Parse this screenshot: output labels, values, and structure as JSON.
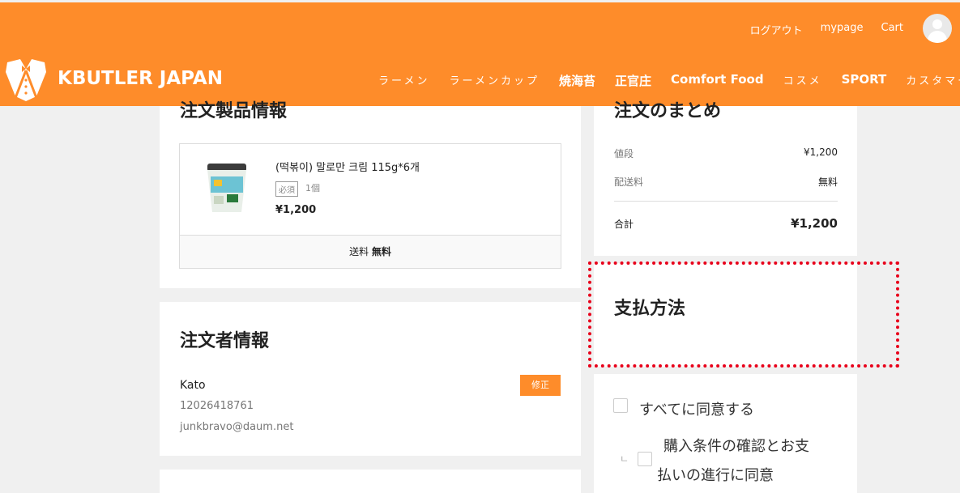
{
  "header": {
    "top_links": [
      "ログアウト",
      "mypage",
      "Cart"
    ],
    "logo_text": "KBUTLER JAPAN",
    "nav": [
      "ラーメン",
      "ラーメンカップ",
      "焼海苔",
      "正官庄",
      "Comfort Food",
      "コスメ",
      "SPORT",
      "カスタマーサ"
    ],
    "accent_color": "#fe8c2a"
  },
  "products": {
    "title": "注文製品情報",
    "item": {
      "name": "(떡볶이) 말로만 크림 115g*6개",
      "badge": "必須",
      "qty": "1個",
      "price": "¥1,200"
    },
    "shipping_label": "送料",
    "shipping_value": "無料"
  },
  "orderer": {
    "title": "注文者情報",
    "name": "Kato",
    "phone": "12026418761",
    "email": "junkbravo@daum.net",
    "edit_label": "修正"
  },
  "summary": {
    "title": "注文のまとめ",
    "rows": [
      {
        "label": "値段",
        "value": "¥1,200"
      },
      {
        "label": "配送料",
        "value": "無料"
      }
    ],
    "total_label": "合計",
    "total_value": "¥1,200"
  },
  "payment": {
    "title": "支払方法",
    "highlight_color": "#e8001a"
  },
  "agreements": {
    "all": "すべてに同意する",
    "purchase_line1": "購入条件の確認とお支",
    "purchase_line2": "払いの進行に同意"
  }
}
